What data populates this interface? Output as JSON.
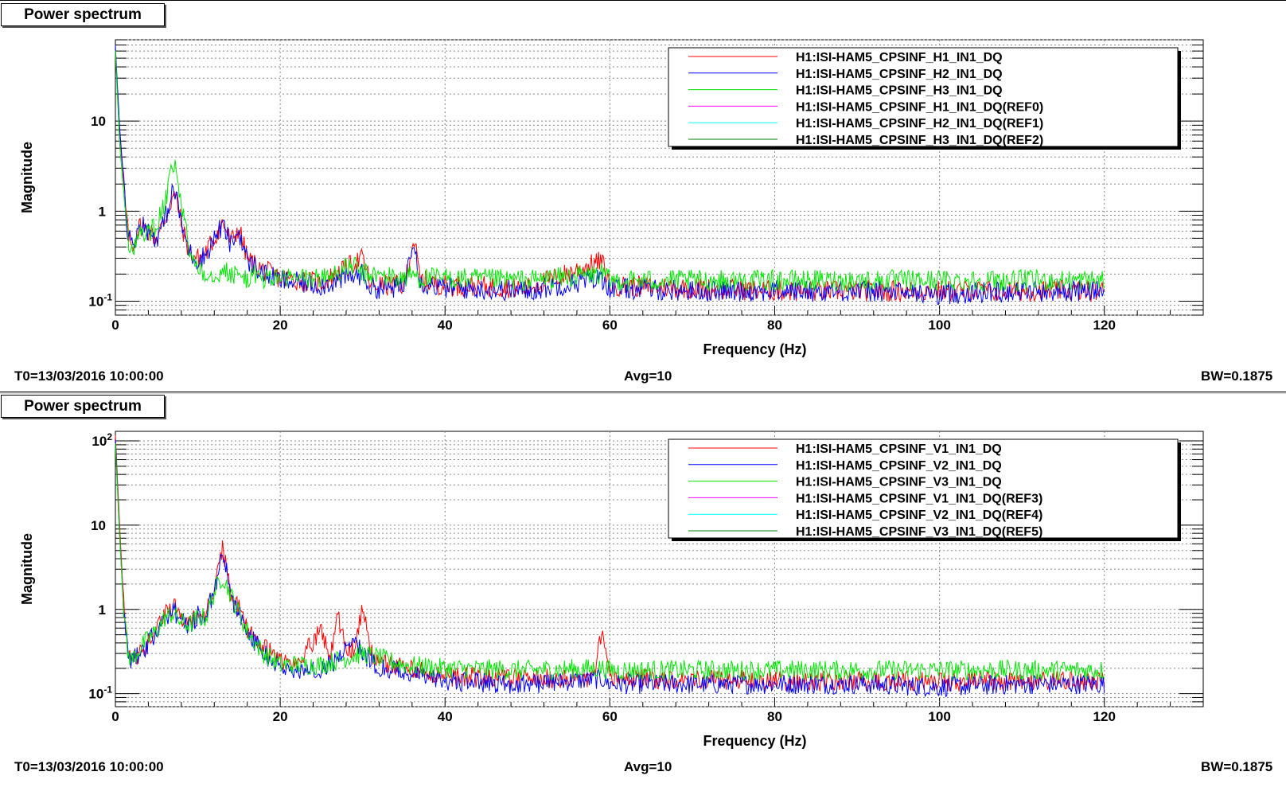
{
  "panels": [
    {
      "title": "Power spectrum",
      "footer": {
        "t0": "T0=13/03/2016 10:00:00",
        "avg": "Avg=10",
        "bw": "BW=0.1875"
      },
      "chart_data": {
        "type": "line",
        "xlabel": "Frequency (Hz)",
        "ylabel": "Magnitude",
        "xlim": [
          0,
          132
        ],
        "ylim": [
          0.07,
          80
        ],
        "yscale": "log",
        "grid": true,
        "legend_position": "top-right",
        "x_ticks": [
          0,
          20,
          40,
          60,
          80,
          100,
          120
        ],
        "x_tick_labels": [
          "0",
          "20",
          "40",
          "60",
          "80",
          "100",
          "120"
        ],
        "y_ticks": [
          0.1,
          1,
          10
        ],
        "y_tick_labels": [
          {
            "base": "10",
            "exp": "-1"
          },
          {
            "base": "1",
            "exp": ""
          },
          {
            "base": "10",
            "exp": ""
          }
        ],
        "series": [
          {
            "name": "H1:ISI-HAM5_CPSINF_H1_IN1_DQ",
            "color": "#ff0000",
            "x": [
              0,
              0.5,
              1,
              1.5,
              2,
              3,
              4,
              5,
              6,
              7,
              7.5,
              8,
              9,
              10,
              11,
              12,
              13,
              13.5,
              14,
              15,
              16,
              17,
              18,
              20,
              25,
              30,
              31,
              35,
              36.2,
              37,
              40,
              50,
              59,
              60,
              70,
              80,
              90,
              100,
              110,
              120
            ],
            "y": [
              60,
              8,
              2,
              0.6,
              0.4,
              0.7,
              0.6,
              0.5,
              0.8,
              1.5,
              1.3,
              0.7,
              0.35,
              0.3,
              0.35,
              0.5,
              0.75,
              0.6,
              0.45,
              0.65,
              0.3,
              0.25,
              0.22,
              0.18,
              0.16,
              0.3,
              0.15,
              0.15,
              0.5,
              0.17,
              0.15,
              0.14,
              0.28,
              0.15,
              0.14,
              0.13,
              0.13,
              0.13,
              0.13,
              0.13
            ]
          },
          {
            "name": "H1:ISI-HAM5_CPSINF_H2_IN1_DQ",
            "color": "#0000ff",
            "x": [
              0,
              0.5,
              1,
              1.5,
              2,
              3,
              4,
              5,
              6,
              7,
              7.5,
              8,
              9,
              10,
              11,
              12,
              13,
              13.5,
              14,
              15,
              16,
              17,
              18,
              20,
              25,
              30,
              31,
              35,
              36.2,
              37,
              40,
              50,
              59,
              60,
              70,
              80,
              90,
              100,
              110,
              120
            ],
            "y": [
              70,
              9,
              2.2,
              0.6,
              0.4,
              0.75,
              0.6,
              0.5,
              0.8,
              1.7,
              1.4,
              0.7,
              0.35,
              0.28,
              0.33,
              0.5,
              0.7,
              0.55,
              0.42,
              0.6,
              0.28,
              0.24,
              0.2,
              0.17,
              0.15,
              0.2,
              0.14,
              0.14,
              0.55,
              0.16,
              0.14,
              0.13,
              0.18,
              0.14,
              0.13,
              0.13,
              0.13,
              0.12,
              0.13,
              0.13
            ]
          },
          {
            "name": "H1:ISI-HAM5_CPSINF_H3_IN1_DQ",
            "color": "#00e600",
            "x": [
              0,
              0.5,
              1,
              1.5,
              2,
              3,
              4,
              5,
              6,
              7,
              7.5,
              8,
              9,
              10,
              11,
              12,
              13,
              14,
              15,
              16,
              17,
              18,
              20,
              25,
              29,
              30,
              35,
              36.2,
              37,
              40,
              50,
              59,
              60,
              70,
              80,
              90,
              100,
              110,
              120
            ],
            "y": [
              60,
              6,
              1.5,
              0.5,
              0.35,
              0.6,
              0.55,
              0.7,
              1.2,
              3.2,
              2.5,
              1.2,
              0.35,
              0.25,
              0.2,
              0.2,
              0.22,
              0.2,
              0.19,
              0.18,
              0.19,
              0.18,
              0.18,
              0.18,
              0.25,
              0.2,
              0.18,
              0.2,
              0.18,
              0.18,
              0.17,
              0.2,
              0.17,
              0.17,
              0.17,
              0.17,
              0.17,
              0.17,
              0.17
            ]
          },
          {
            "name": "H1:ISI-HAM5_CPSINF_H1_IN1_DQ(REF0)",
            "color": "#ff00ff",
            "x": [],
            "y": []
          },
          {
            "name": "H1:ISI-HAM5_CPSINF_H2_IN1_DQ(REF1)",
            "color": "#00ffff",
            "x": [],
            "y": []
          },
          {
            "name": "H1:ISI-HAM5_CPSINF_H3_IN1_DQ(REF2)",
            "color": "#008000",
            "x": [],
            "y": []
          }
        ]
      }
    },
    {
      "title": "Power spectrum",
      "footer": {
        "t0": "T0=13/03/2016 10:00:00",
        "avg": "Avg=10",
        "bw": "BW=0.1875"
      },
      "chart_data": {
        "type": "line",
        "xlabel": "Frequency (Hz)",
        "ylabel": "Magnitude",
        "xlim": [
          0,
          132
        ],
        "ylim": [
          0.07,
          130
        ],
        "yscale": "log",
        "grid": true,
        "legend_position": "top-right",
        "x_ticks": [
          0,
          20,
          40,
          60,
          80,
          100,
          120
        ],
        "x_tick_labels": [
          "0",
          "20",
          "40",
          "60",
          "80",
          "100",
          "120"
        ],
        "y_ticks": [
          0.1,
          1,
          10,
          100
        ],
        "y_tick_labels": [
          {
            "base": "10",
            "exp": "-1"
          },
          {
            "base": "1",
            "exp": ""
          },
          {
            "base": "10",
            "exp": ""
          },
          {
            "base": "10",
            "exp": "2"
          }
        ],
        "series": [
          {
            "name": "H1:ISI-HAM5_CPSINF_V1_IN1_DQ",
            "color": "#ff0000",
            "x": [
              0,
              0.5,
              1,
              1.5,
              2,
              3,
              4,
              5,
              6,
              7,
              8,
              9,
              10,
              11,
              12,
              12.5,
              13,
              13.5,
              14,
              15,
              16,
              17,
              18,
              19,
              20,
              22,
              25,
              26,
              27,
              28,
              29,
              30,
              31,
              32,
              35,
              40,
              50,
              58,
              59,
              60,
              70,
              80,
              90,
              100,
              110,
              120
            ],
            "y": [
              120,
              10,
              1.2,
              0.3,
              0.25,
              0.3,
              0.4,
              0.6,
              0.9,
              1.1,
              0.8,
              0.7,
              0.9,
              0.9,
              1.8,
              3,
              5.5,
              3,
              1.5,
              1,
              0.6,
              0.45,
              0.35,
              0.3,
              0.25,
              0.22,
              0.6,
              0.25,
              0.9,
              0.3,
              0.35,
              1.0,
              0.3,
              0.25,
              0.2,
              0.16,
              0.15,
              0.15,
              0.5,
              0.15,
              0.15,
              0.14,
              0.14,
              0.14,
              0.14,
              0.14
            ]
          },
          {
            "name": "H1:ISI-HAM5_CPSINF_V2_IN1_DQ",
            "color": "#0000ff",
            "x": [
              0,
              0.5,
              1,
              1.5,
              2,
              3,
              4,
              5,
              6,
              7,
              8,
              9,
              10,
              11,
              12,
              12.5,
              13,
              13.5,
              14,
              15,
              16,
              17,
              18,
              19,
              20,
              22,
              25,
              27,
              29,
              30,
              31,
              32,
              35,
              40,
              50,
              59,
              60,
              70,
              80,
              90,
              100,
              110,
              120
            ],
            "y": [
              100,
              8,
              1,
              0.3,
              0.25,
              0.3,
              0.4,
              0.55,
              0.8,
              1.0,
              0.75,
              0.65,
              0.85,
              0.85,
              1.7,
              2.8,
              5,
              2.8,
              1.4,
              0.9,
              0.55,
              0.4,
              0.3,
              0.25,
              0.2,
              0.18,
              0.2,
              0.25,
              0.5,
              0.3,
              0.25,
              0.2,
              0.18,
              0.14,
              0.13,
              0.15,
              0.13,
              0.13,
              0.13,
              0.13,
              0.12,
              0.13,
              0.13
            ]
          },
          {
            "name": "H1:ISI-HAM5_CPSINF_V3_IN1_DQ",
            "color": "#00e600",
            "x": [
              0,
              0.5,
              1,
              1.5,
              2,
              3,
              4,
              5,
              6,
              7,
              8,
              9,
              10,
              11,
              12,
              13,
              14,
              15,
              16,
              17,
              18,
              20,
              25,
              30,
              35,
              40,
              50,
              59,
              60,
              70,
              80,
              90,
              100,
              110,
              120
            ],
            "y": [
              90,
              8,
              1,
              0.3,
              0.25,
              0.35,
              0.45,
              0.55,
              0.8,
              0.9,
              0.7,
              0.65,
              0.8,
              0.8,
              1.6,
              2.5,
              1.5,
              0.9,
              0.55,
              0.4,
              0.3,
              0.22,
              0.22,
              0.3,
              0.22,
              0.2,
              0.19,
              0.2,
              0.19,
              0.19,
              0.19,
              0.19,
              0.19,
              0.19,
              0.19
            ]
          },
          {
            "name": "H1:ISI-HAM5_CPSINF_V1_IN1_DQ(REF3)",
            "color": "#ff00ff",
            "x": [],
            "y": []
          },
          {
            "name": "H1:ISI-HAM5_CPSINF_V2_IN1_DQ(REF4)",
            "color": "#00ffff",
            "x": [],
            "y": []
          },
          {
            "name": "H1:ISI-HAM5_CPSINF_V3_IN1_DQ(REF5)",
            "color": "#008000",
            "x": [],
            "y": []
          }
        ]
      }
    }
  ]
}
